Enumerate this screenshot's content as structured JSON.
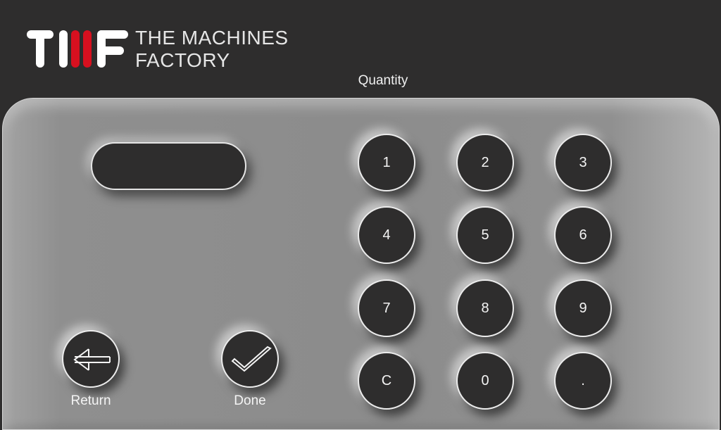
{
  "brand": {
    "logo_text": "TMF",
    "name_line1": "THE MACHINES",
    "name_line2": "FACTORY"
  },
  "screen": {
    "title": "Quantity"
  },
  "display": {
    "value": ""
  },
  "keypad": {
    "keys": [
      "1",
      "2",
      "3",
      "4",
      "5",
      "6",
      "7",
      "8",
      "9",
      "C",
      "0",
      "."
    ]
  },
  "actions": {
    "return_label": "Return",
    "done_label": "Done",
    "return_icon": "arrow-left-icon",
    "done_icon": "checkmark-icon"
  },
  "colors": {
    "background": "#2e2d2d",
    "panel": "#8c8c8c",
    "accent_red": "#d7101f",
    "key": "#2e2d2d",
    "text": "#f4f4f4"
  }
}
